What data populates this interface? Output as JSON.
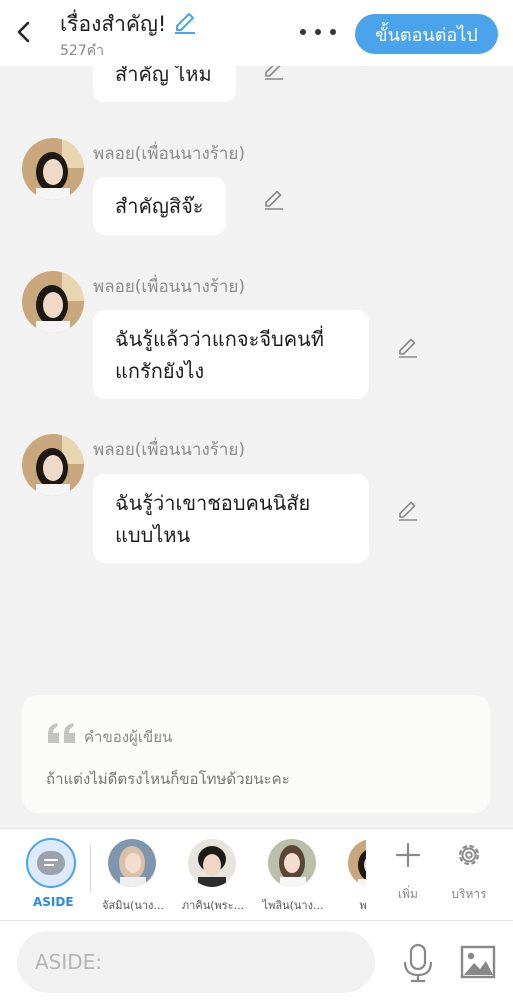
{
  "header": {
    "title": "เรื่องสำคัญ!",
    "word_count": "527คำ",
    "next_button": "ขั้นตอนต่อไป",
    "icons": {
      "back": "chevron-left-icon",
      "edit": "pencil-icon",
      "more": "more-dots-icon"
    }
  },
  "chat": {
    "partial_bubble": "สำคัญ ไหม",
    "messages": [
      {
        "sender": "พลอย(เพื่อนนางร้าย)",
        "lines": [
          "สำคัญสิจ๊ะ"
        ]
      },
      {
        "sender": "พลอย(เพื่อนนางร้าย)",
        "lines": [
          "ฉันรู้แล้วว่าแกจะจีบคนที่",
          "แกรักยังไง"
        ]
      },
      {
        "sender": "พลอย(เพื่อนนางร้าย)",
        "lines": [
          "ฉันรู้ว่าเขาชอบคนนิสัย",
          "แบบไหน"
        ]
      }
    ]
  },
  "aside_card": {
    "title": "คำของผู้เขียน",
    "text": "ถ้าแต่งไม่ดีตรงไหนก็ขอโทษด้วยนะคะ"
  },
  "strip": {
    "aside_label": "ASIDE",
    "characters": [
      {
        "name": "จัสมิน(นาง..."
      },
      {
        "name": "ภาคิน(พระ..."
      },
      {
        "name": "ไพลิน(นาง..."
      },
      {
        "name": "พลอย"
      }
    ],
    "add_label": "เพิ่ม",
    "manage_label": "บริหาร"
  },
  "input": {
    "placeholder": "ASIDE:",
    "value": ""
  },
  "colors": {
    "accent": "#4ba3ec",
    "background": "#f2f2f2",
    "bubble": "#ffffff"
  }
}
